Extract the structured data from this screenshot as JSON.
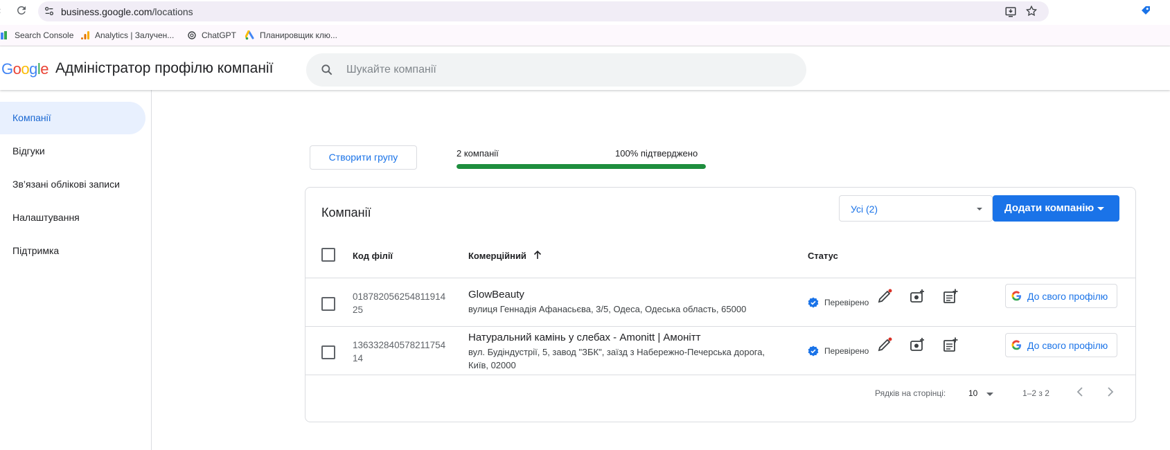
{
  "browser": {
    "url_host": "business.google.com",
    "url_path": "/locations",
    "bookmarks": [
      {
        "label": "Search Console",
        "icon": "search-console-icon"
      },
      {
        "label": "Analytics | Залучен...",
        "icon": "analytics-icon"
      },
      {
        "label": "ChatGPT",
        "icon": "chatgpt-icon"
      },
      {
        "label": "Планировщик клю...",
        "icon": "google-ads-icon"
      }
    ]
  },
  "header": {
    "logo_letters": [
      "G",
      "o",
      "o",
      "g",
      "l",
      "e"
    ],
    "logo_colors": [
      "#4285F4",
      "#EA4335",
      "#FBBC05",
      "#4285F4",
      "#34A853",
      "#EA4335"
    ],
    "title": "Адміністратор профілю компанії",
    "search_placeholder": "Шукайте компанії"
  },
  "sidebar": {
    "items": [
      {
        "label": "Компанії",
        "active": true
      },
      {
        "label": "Відгуки",
        "active": false
      },
      {
        "label": "Зв’язані облікові записи",
        "active": false
      },
      {
        "label": "Налаштування",
        "active": false
      },
      {
        "label": "Підтримка",
        "active": false
      }
    ]
  },
  "summary": {
    "create_group_label": "Створити групу",
    "count_label": "2 компанії",
    "verified_label": "100% підтверджено",
    "verified_fraction": 1.0
  },
  "card": {
    "title": "Компанії",
    "filter_value": "Усі (2)",
    "add_button_label": "Додати компанію",
    "columns": {
      "code": "Код філії",
      "name": "Комерційний",
      "status": "Статус"
    },
    "rows": [
      {
        "code": "01878205625481191425",
        "name": "GlowBeauty",
        "address": "вулиця Геннадія Афанасьєва, 3/5, Одеса, Одеська область, 65000",
        "status": "Перевірено",
        "profile_button": "До свого профілю"
      },
      {
        "code": "13633284057821175414",
        "name": "Натуральний камінь у слебах - Amonitt | Амонітт",
        "address": "вул. Будіндустрії, 5, завод \"ЗБК\", заїзд з Набережно-Печерська дорога, Київ, 02000",
        "status": "Перевірено",
        "profile_button": "До свого профілю"
      }
    ],
    "pager": {
      "rows_label": "Рядків на сторінці:",
      "rows_value": "10",
      "range": "1–2 з 2"
    }
  },
  "colors": {
    "accent": "#1a73e8",
    "progress": "#1e8e3e",
    "verified": "#1a73e8",
    "notification_dot": "#d93025"
  }
}
